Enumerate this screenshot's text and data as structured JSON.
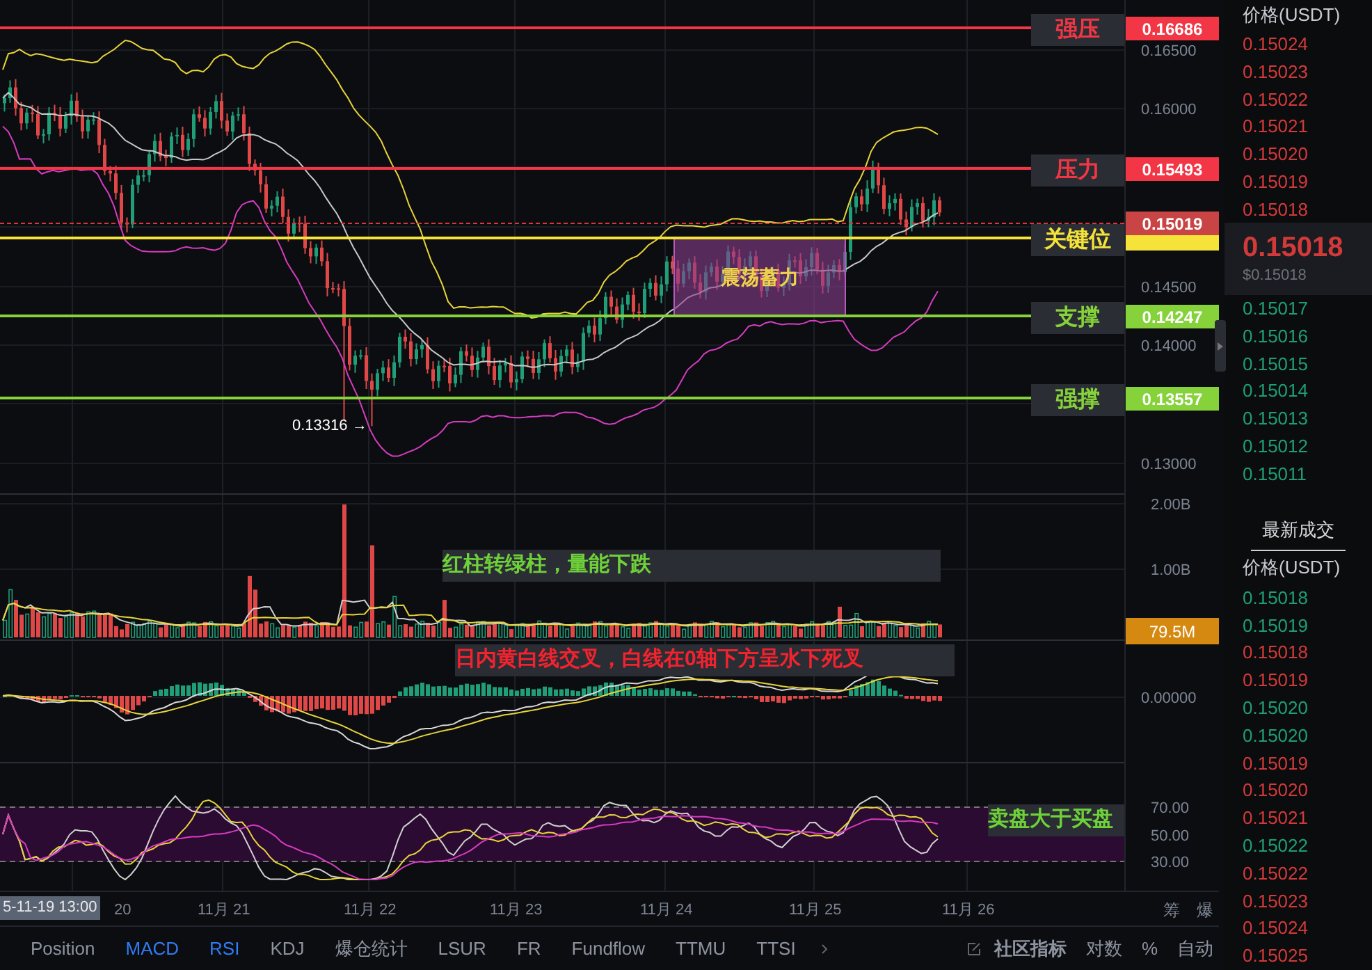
{
  "price_levels": [
    {
      "label": "强压",
      "price": "0.16686",
      "color": "#f23645"
    },
    {
      "label": "压力",
      "price": "0.15493",
      "color": "#f23645"
    },
    {
      "label": "关键位",
      "color": "#f5e33a"
    },
    {
      "label": "支撑",
      "price": "0.14247",
      "color": "#86d23a"
    },
    {
      "label": "强撑",
      "price": "0.13557",
      "color": "#86d23a"
    }
  ],
  "last_price_tag": "0.15019",
  "low_marker": "0.13316 →",
  "range_box": {
    "label": "震荡蓄力"
  },
  "notes": [
    {
      "text": "红柱转绿柱，量能下跌",
      "kind": "positive"
    },
    {
      "text": "日内黄白线交叉，白线在0轴下方呈水下死叉",
      "kind": "negative"
    },
    {
      "text": "卖盘大于买盘",
      "kind": "positive"
    }
  ],
  "price_axis": [
    "0.16500",
    "0.16000",
    "0.14500",
    "0.14000",
    "0.13000"
  ],
  "volume_axis": [
    "2.00B",
    "1.00B"
  ],
  "volume_tag": "79.5M",
  "macd_axis": [
    "0.00000"
  ],
  "rsi_axis": [
    "70.00",
    "50.00",
    "30.00"
  ],
  "time_axis": {
    "cursor": "5-11-19 13:00",
    "labels": [
      "20",
      "11月 21",
      "11月 22",
      "11月 23",
      "11月 24",
      "11月 25",
      "11月 26"
    ]
  },
  "axis_buttons": [
    "筹",
    "爆"
  ],
  "indicator_tabs": [
    {
      "label": "Position",
      "selected": false
    },
    {
      "label": "MACD",
      "selected": true
    },
    {
      "label": "RSI",
      "selected": true
    },
    {
      "label": "KDJ",
      "selected": false
    },
    {
      "label": "爆仓统计",
      "selected": false
    },
    {
      "label": "LSUR",
      "selected": false
    },
    {
      "label": "FR",
      "selected": false
    },
    {
      "label": "Fundflow",
      "selected": false
    },
    {
      "label": "TTMU",
      "selected": false
    },
    {
      "label": "TTSI",
      "selected": false
    }
  ],
  "toolbar": [
    "社区指标",
    "对数",
    "%",
    "自动"
  ],
  "order_book": {
    "header": "价格(USDT)",
    "asks": [
      "0.15024",
      "0.15023",
      "0.15022",
      "0.15021",
      "0.15020",
      "0.15019",
      "0.15018"
    ],
    "last_price": "0.15018",
    "last_price_usd": "$0.15018",
    "bids": [
      "0.15017",
      "0.15016",
      "0.15015",
      "0.15014",
      "0.15013",
      "0.15012",
      "0.15011"
    ]
  },
  "trades": {
    "tab": "最新成交",
    "header": "价格(USDT)",
    "rows": [
      {
        "price": "0.15018",
        "kind": "buy"
      },
      {
        "price": "0.15019",
        "kind": "buy"
      },
      {
        "price": "0.15018",
        "kind": "sell"
      },
      {
        "price": "0.15019",
        "kind": "sell"
      },
      {
        "price": "0.15020",
        "kind": "buy"
      },
      {
        "price": "0.15020",
        "kind": "buy"
      },
      {
        "price": "0.15019",
        "kind": "sell"
      },
      {
        "price": "0.15020",
        "kind": "sell"
      },
      {
        "price": "0.15021",
        "kind": "sell"
      },
      {
        "price": "0.15022",
        "kind": "buy"
      },
      {
        "price": "0.15022",
        "kind": "sell"
      },
      {
        "price": "0.15023",
        "kind": "sell"
      },
      {
        "price": "0.15024",
        "kind": "sell"
      },
      {
        "price": "0.15025",
        "kind": "sell"
      }
    ]
  }
}
